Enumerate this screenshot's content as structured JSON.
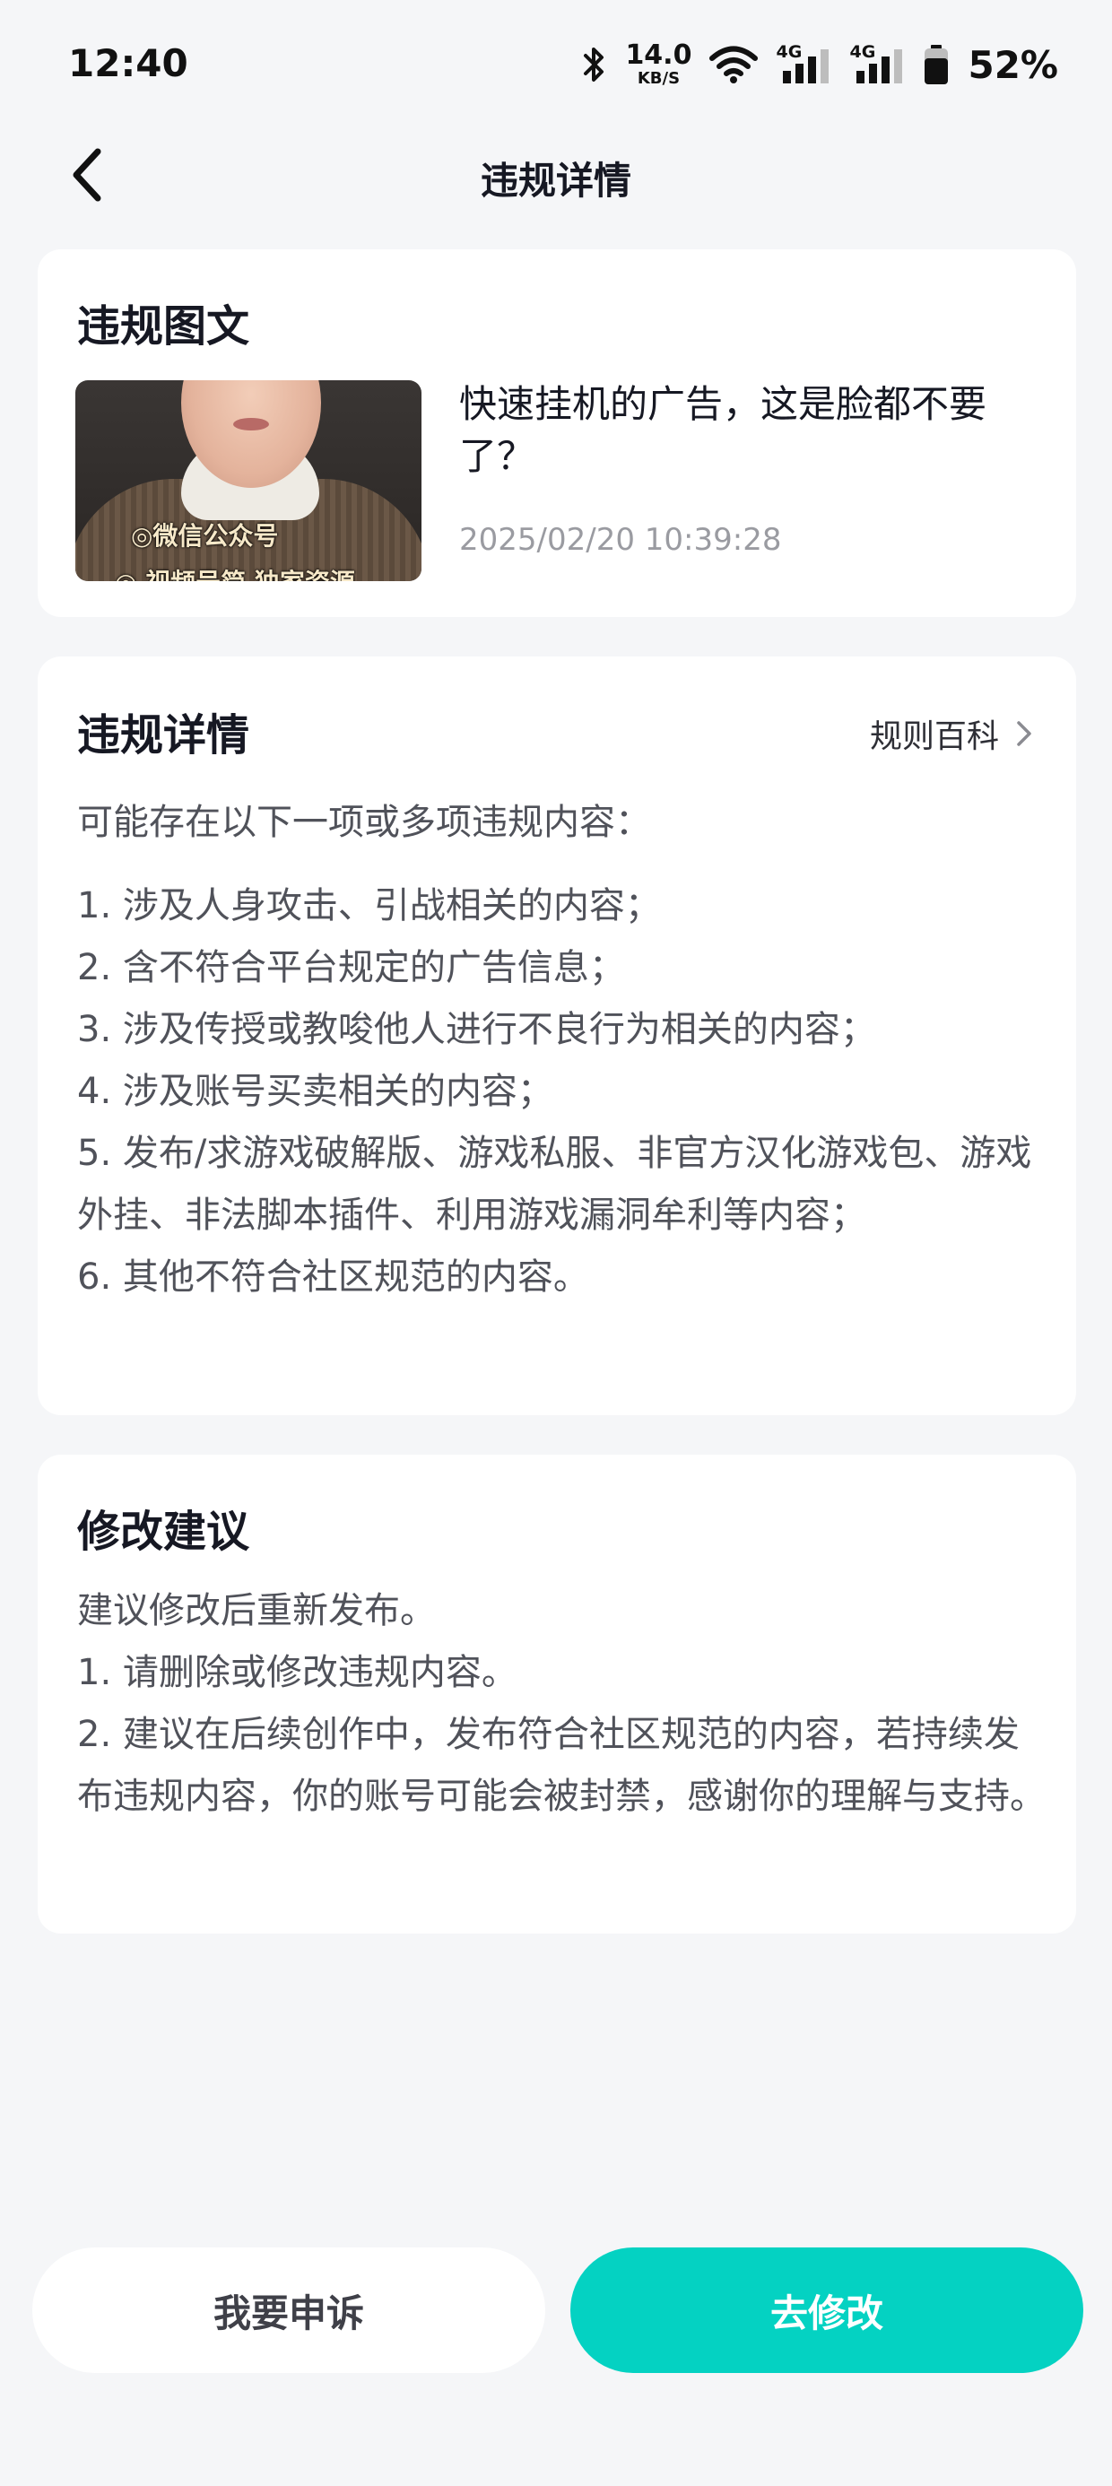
{
  "status_bar": {
    "time": "12:40",
    "net_speed_value": "14.0",
    "net_speed_unit": "KB/S",
    "signal1_tag": "4G",
    "signal2_tag": "4G",
    "battery": "52%",
    "icons": [
      "bluetooth-icon",
      "wifi-icon",
      "signal-icon",
      "battery-icon"
    ]
  },
  "nav": {
    "title": "违规详情",
    "back_icon": "chevron-left-icon"
  },
  "post_card": {
    "title": "违规图文",
    "thumbnail_caption_1": "◎微信公众号",
    "thumbnail_caption_2": "◎ 视频号简 独家资源",
    "text": "快速挂机的广告，这是脸都不要了？",
    "timestamp": "2025/02/20 10:39:28"
  },
  "detail_card": {
    "title": "违规详情",
    "rules_link": "规则百科",
    "intro": "可能存在以下一项或多项违规内容：",
    "items": [
      "1. 涉及人身攻击、引战相关的内容；",
      "2. 含不符合平台规定的广告信息；",
      "3. 涉及传授或教唆他人进行不良行为相关的内容；",
      "4. 涉及账号买卖相关的内容；",
      "5. 发布/求游戏破解版、游戏私服、非官方汉化游戏包、游戏外挂、非法脚本插件、利用游戏漏洞牟利等内容；",
      "6. 其他不符合社区规范的内容。"
    ]
  },
  "advice_card": {
    "title": "修改建议",
    "lines": [
      "建议修改后重新发布。",
      "1. 请删除或修改违规内容。",
      "2. 建议在后续创作中，发布符合社区规范的内容，若持续发布违规内容，你的账号可能会被封禁，感谢你的理解与支持。"
    ]
  },
  "buttons": {
    "appeal": "我要申诉",
    "modify": "去修改"
  },
  "colors": {
    "accent": "#04d2c2",
    "background": "#f5f6f8",
    "card": "#ffffff",
    "body_text": "#50525a",
    "muted_text": "#9a9ba1"
  }
}
